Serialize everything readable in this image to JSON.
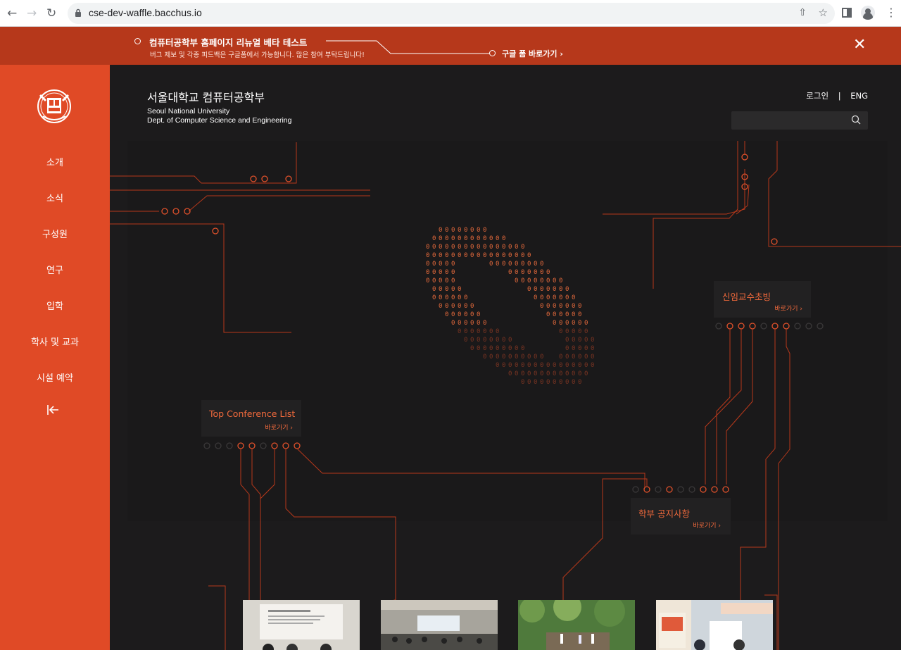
{
  "browser": {
    "url": "cse-dev-waffle.bacchus.io"
  },
  "banner": {
    "title": "컴퓨터공학부 홈페이지 리뉴얼 베타 테스트",
    "subtitle": "버그 제보 및 각종 피드백은 구글폼에서 가능합니다. 많은 참여 부탁드립니다!",
    "link": "구글 폼 바로가기 ›"
  },
  "sidebar": {
    "items": [
      {
        "label": "소개"
      },
      {
        "label": "소식"
      },
      {
        "label": "구성원"
      },
      {
        "label": "연구"
      },
      {
        "label": "입학"
      },
      {
        "label": "학사 및 교과"
      },
      {
        "label": "시설 예약"
      }
    ],
    "collapse_icon": "collapse-left-icon"
  },
  "header": {
    "title": "서울대학교 컴퓨터공학부",
    "subtitle_line1": "Seoul National University",
    "subtitle_line2": "Dept. of Computer Science and Engineering",
    "login": "로그인",
    "divider": "|",
    "lang": "ENG",
    "search_icon": "search-icon"
  },
  "cards": {
    "professor": {
      "title": "신임교수초빙",
      "go": "바로가기 ›"
    },
    "conference": {
      "title": "Top Conference List",
      "go": "바로가기 ›"
    },
    "notice": {
      "title": "학부 공지사항",
      "go": "바로가기 ›"
    }
  },
  "colors": {
    "accent": "#e04a26",
    "banner": "#b6381b",
    "background": "#1c1b1c",
    "highlight": "#f26a3c"
  }
}
